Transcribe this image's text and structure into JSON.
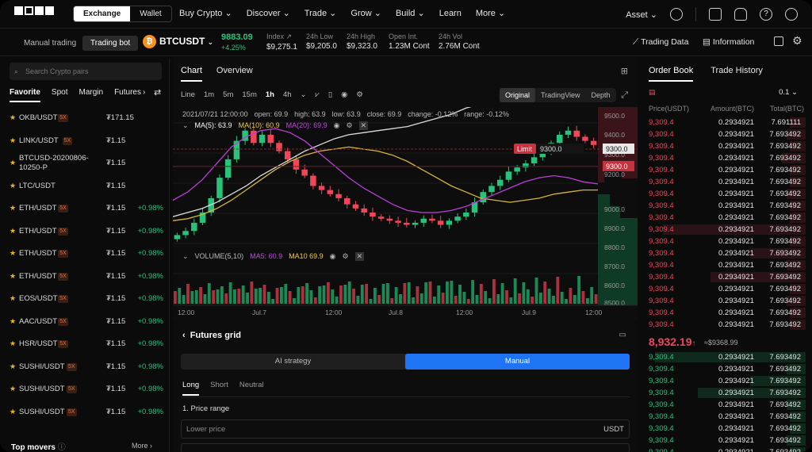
{
  "nav": {
    "seg": [
      "Exchange",
      "Wallet"
    ],
    "menu": [
      "Buy Crypto",
      "Discover",
      "Trade",
      "Grow",
      "Build",
      "Learn",
      "More"
    ],
    "asset": "Asset"
  },
  "ticker": {
    "manual": "Manual trading",
    "bot": "Trading bot",
    "coin_letter": "₿",
    "symbol": "BTCUSDT",
    "last": "9883.09",
    "change": "+4.25%",
    "stats": [
      {
        "label": "Index",
        "value": "$9,275.1"
      },
      {
        "label": "24h Low",
        "value": "$9,205.0"
      },
      {
        "label": "24h High",
        "value": "$9,323.0"
      },
      {
        "label": "Open Int.",
        "value": "1.23M Cont"
      },
      {
        "label": "24h Vol",
        "value": "2.76M Cont"
      }
    ],
    "trading_data": "Trading Data",
    "information": "Information"
  },
  "left": {
    "search_placeholder": "Search Crypto pairs",
    "tabs": [
      "Favorite",
      "Spot",
      "Margin",
      "Futures"
    ],
    "rows": [
      {
        "pair": "OKB/USDT",
        "lev": "5X",
        "price": "₮171.15",
        "chg": ""
      },
      {
        "pair": "LINK/USDT",
        "lev": "5X",
        "price": "₮1.15",
        "chg": ""
      },
      {
        "pair": "BTCUSD-20200806-10250-P",
        "lev": "",
        "price": "₮1.15",
        "chg": ""
      },
      {
        "pair": "LTC/USDT",
        "lev": "",
        "price": "₮1.15",
        "chg": ""
      },
      {
        "pair": "ETH/USDT",
        "lev": "5X",
        "price": "₮1.15",
        "chg": "+0.98%"
      },
      {
        "pair": "ETH/USDT",
        "lev": "5X",
        "price": "₮1.15",
        "chg": "+0.98%"
      },
      {
        "pair": "ETH/USDT",
        "lev": "5X",
        "price": "₮1.15",
        "chg": "+0.98%"
      },
      {
        "pair": "ETH/USDT",
        "lev": "5X",
        "price": "₮1.15",
        "chg": "+0.98%"
      },
      {
        "pair": "EOS/USDT",
        "lev": "5X",
        "price": "₮1.15",
        "chg": "+0.98%"
      },
      {
        "pair": "AAC/USDT",
        "lev": "5X",
        "price": "₮1.15",
        "chg": "+0.98%"
      },
      {
        "pair": "HSR/USDT",
        "lev": "5X",
        "price": "₮1.15",
        "chg": "+0.98%"
      },
      {
        "pair": "SUSHI/USDT",
        "lev": "5X",
        "price": "₮1.15",
        "chg": "+0.98%"
      },
      {
        "pair": "SUSHI/USDT",
        "lev": "5X",
        "price": "₮1.15",
        "chg": "+0.98%"
      },
      {
        "pair": "SUSHI/USDT",
        "lev": "5X",
        "price": "₮1.15",
        "chg": "+0.98%"
      }
    ],
    "top_movers": "Top movers",
    "more": "More"
  },
  "chart": {
    "tabs": [
      "Chart",
      "Overview"
    ],
    "intervals": [
      "Line",
      "1m",
      "5m",
      "15m",
      "1h",
      "4h"
    ],
    "active_interval": "1h",
    "views": [
      "Original",
      "TradingView",
      "Depth"
    ],
    "ohlc": {
      "date": "2021/07/21 12:00:00",
      "open": "open: 69.9",
      "high": "high: 63.9",
      "low": "low: 63.9",
      "close": "close: 69.9",
      "change": "change: -0.12%",
      "range": "range: -0.12%"
    },
    "ma": {
      "ma5": "MA(5): 63.9",
      "ma10": "MA(10): 60.9",
      "ma20": "MA(20): 69.9"
    },
    "volume": {
      "label": "VOLUME(5,10)",
      "ma5": "MA5: 60.9",
      "ma10": "MA10 69.9"
    },
    "limit_label": "Limit",
    "limit_price": "9300.0",
    "right_tag1": "9300.0",
    "right_tag2": "9300.0"
  },
  "chart_data": {
    "type": "candlestick",
    "x_ticks": [
      "12:00",
      "Jul.7",
      "12:00",
      "Jul.8",
      "12:00",
      "Jul.9",
      "12:00"
    ],
    "y_ticks": [
      "9500.0",
      "9400.0",
      "9300.0",
      "9200.0",
      "9000.0",
      "8900.0",
      "8800.0",
      "8700.0",
      "8600.0",
      "8500.0"
    ],
    "close": [
      8880,
      8900,
      8940,
      8990,
      9060,
      9160,
      9250,
      9340,
      9390,
      9330,
      9370,
      9330,
      9290,
      9250,
      9200,
      9170,
      9120,
      9100,
      9080,
      9060,
      9030,
      9010,
      8990,
      8970,
      8960,
      8950,
      8940,
      8930,
      8940,
      8960,
      8950,
      8930,
      8950,
      8970,
      8990,
      9040,
      9090,
      9120,
      9150,
      9190,
      9210,
      9230,
      9260,
      9290,
      9330,
      9370,
      9390,
      9360,
      9340,
      9320
    ],
    "ma_white": [
      8970,
      8990,
      9010,
      9040,
      9080,
      9120,
      9170,
      9210,
      9250,
      9290,
      9320,
      9350,
      9370,
      9380,
      9390,
      9400,
      9410,
      9430,
      9450,
      9470,
      9500,
      9520,
      9540,
      9560,
      9570,
      9580,
      9590,
      9590,
      9590,
      9590
    ],
    "ma_yellow": [
      8950,
      8960,
      8980,
      9010,
      9050,
      9100,
      9150,
      9200,
      9240,
      9270,
      9290,
      9300,
      9310,
      9300,
      9290,
      9270,
      9240,
      9200,
      9160,
      9120,
      9090,
      9060,
      9050,
      9040,
      9050,
      9060,
      9080,
      9090,
      9100,
      9100
    ],
    "ma_purple": [
      9050,
      9090,
      9150,
      9230,
      9310,
      9360,
      9390,
      9400,
      9380,
      9340,
      9280,
      9220,
      9160,
      9110,
      9070,
      9030,
      9000,
      8990,
      8990,
      9000,
      9020,
      9050,
      9080,
      9110,
      9140,
      9160,
      9170,
      9160,
      9140,
      9130
    ]
  },
  "grid": {
    "title": "Futures grid",
    "modes": [
      "AI strategy",
      "Manual"
    ],
    "dirs": [
      "Long",
      "Short",
      "Neutral"
    ],
    "price_range": "1. Price range",
    "lower_placeholder": "Lower price",
    "unit": "USDT"
  },
  "orderbook": {
    "tabs": [
      "Order Book",
      "Trade History"
    ],
    "precision": "0.1",
    "head": [
      "Price(USDT)",
      "Amount(BTC)",
      "Total(BTC)"
    ],
    "asks": [
      {
        "p": "9,309.4",
        "a": "0.2934921",
        "t": "7.691111",
        "d": 0.1
      },
      {
        "p": "9,309.4",
        "a": "0.2934921",
        "t": "7.693492",
        "d": 0.12
      },
      {
        "p": "9,309.4",
        "a": "0.2934921",
        "t": "7.693492",
        "d": 0.1
      },
      {
        "p": "9,309.4",
        "a": "0.2934921",
        "t": "7.693492",
        "d": 0.15
      },
      {
        "p": "9,309.4",
        "a": "0.2934921",
        "t": "7.693492",
        "d": 0.1
      },
      {
        "p": "9,309.4",
        "a": "0.2934921",
        "t": "7.693492",
        "d": 0.1
      },
      {
        "p": "9,309.4",
        "a": "0.2934921",
        "t": "7.693492",
        "d": 0.12
      },
      {
        "p": "9,309.4",
        "a": "0.2934921",
        "t": "7.693492",
        "d": 0.1
      },
      {
        "p": "9,309.4",
        "a": "0.2934921",
        "t": "7.693492",
        "d": 0.1
      },
      {
        "p": "9,309.4",
        "a": "0.2934921",
        "t": "7.693492",
        "d": 0.9
      },
      {
        "p": "9,309.4",
        "a": "0.2934921",
        "t": "7.693492",
        "d": 0.1
      },
      {
        "p": "9,309.4",
        "a": "0.2934921",
        "t": "7.693492",
        "d": 0.35
      },
      {
        "p": "9,309.4",
        "a": "0.2934921",
        "t": "7.693492",
        "d": 0.12
      },
      {
        "p": "9,309.4",
        "a": "0.2934921",
        "t": "7.693492",
        "d": 0.6
      },
      {
        "p": "9,309.4",
        "a": "0.2934921",
        "t": "7.693492",
        "d": 0.1
      },
      {
        "p": "9,309.4",
        "a": "0.2934921",
        "t": "7.693492",
        "d": 0.12
      },
      {
        "p": "9,309.4",
        "a": "0.2934921",
        "t": "7.693492",
        "d": 0.1
      },
      {
        "p": "9,309.4",
        "a": "0.2934921",
        "t": "7.693492",
        "d": 0.1
      }
    ],
    "mid_price": "8,932.19",
    "mid_arrow": "↑",
    "mid_usd": "≈$9368.99",
    "bids": [
      {
        "p": "9,309.4",
        "a": "0.2934921",
        "t": "7.693492",
        "d": 0.95
      },
      {
        "p": "9,309.4",
        "a": "0.2934921",
        "t": "7.693492",
        "d": 0.12
      },
      {
        "p": "9,309.4",
        "a": "0.2934921",
        "t": "7.693492",
        "d": 0.35
      },
      {
        "p": "9,309.4",
        "a": "0.2934921",
        "t": "7.693492",
        "d": 0.68
      },
      {
        "p": "9,309.4",
        "a": "0.2934921",
        "t": "7.693492",
        "d": 0.12
      },
      {
        "p": "9,309.4",
        "a": "0.2934921",
        "t": "7.693492",
        "d": 0.1
      },
      {
        "p": "9,309.4",
        "a": "0.2934921",
        "t": "7.693492",
        "d": 0.1
      },
      {
        "p": "9,309.4",
        "a": "0.2934921",
        "t": "7.693492",
        "d": 0.12
      },
      {
        "p": "9,309.4",
        "a": "0.2934921",
        "t": "7.693492",
        "d": 0.1
      }
    ]
  }
}
